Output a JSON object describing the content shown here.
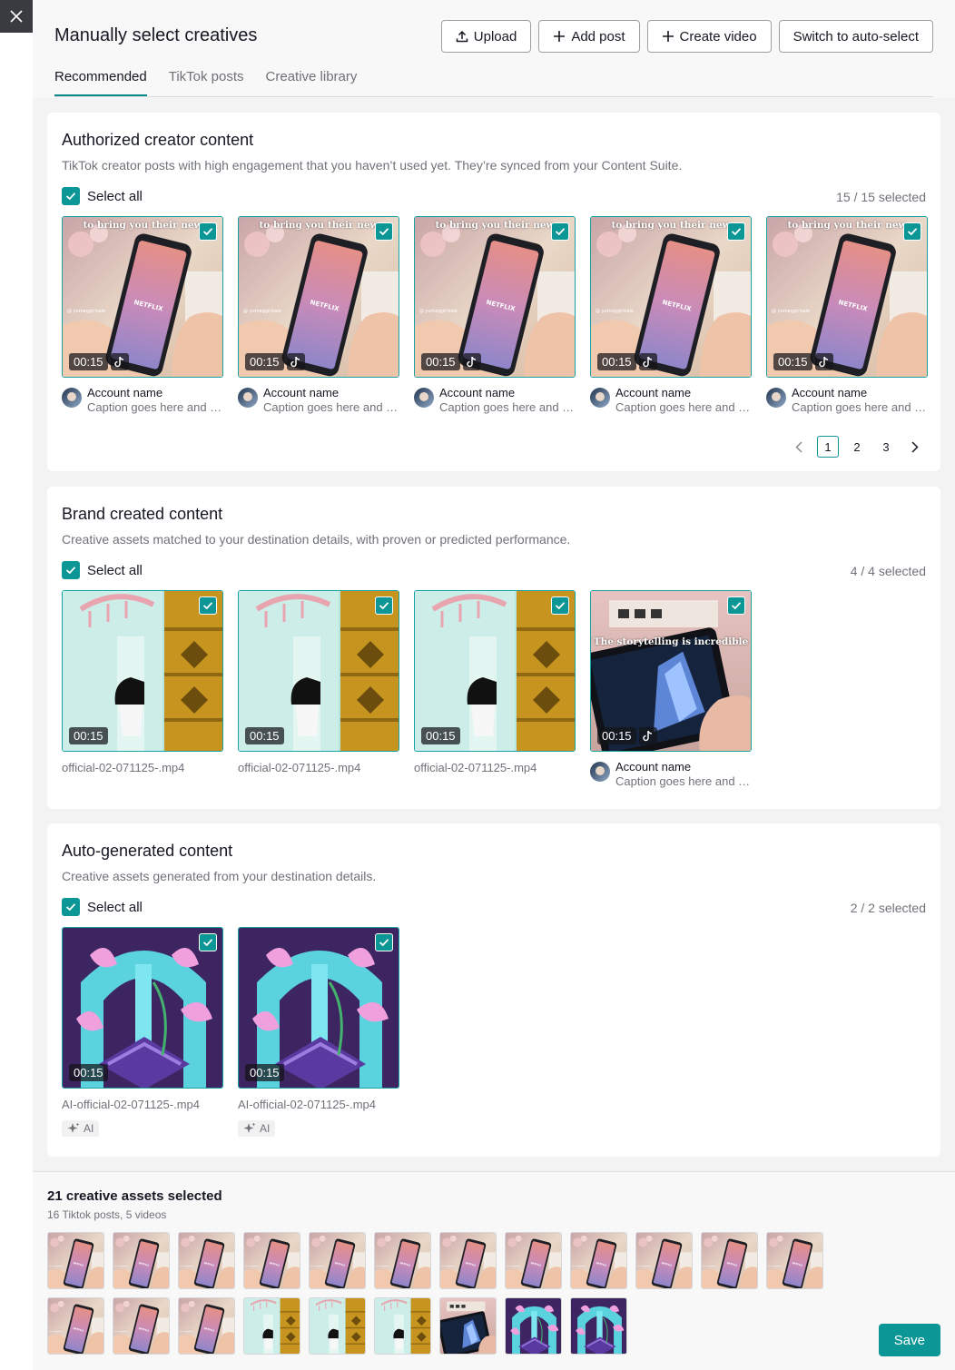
{
  "header": {
    "title": "Manually select creatives",
    "buttons": {
      "upload": "Upload",
      "add_post": "Add post",
      "create_video": "Create video",
      "switch_auto": "Switch to auto-select"
    },
    "tabs": [
      "Recommended",
      "TikTok posts",
      "Creative library"
    ],
    "active_tab": "Recommended"
  },
  "sections": {
    "authorized": {
      "title": "Authorized creator content",
      "description": "TikTok creator posts with high engagement that you haven’t used yet. They’re synced from your Content Suite.",
      "select_all": "Select all",
      "count": "15 / 15 selected",
      "items": [
        {
          "duration": "00:15",
          "overlay": "to bring you their new",
          "account": "Account name",
          "caption": "Caption goes here and truncates"
        },
        {
          "duration": "00:15",
          "overlay": "to bring you their new",
          "account": "Account name",
          "caption": "Caption goes here and truncates"
        },
        {
          "duration": "00:15",
          "overlay": "to bring you their new",
          "account": "Account name",
          "caption": "Caption goes here and truncates"
        },
        {
          "duration": "00:15",
          "overlay": "to bring you their new",
          "account": "Account name",
          "caption": "Caption goes here and truncates"
        },
        {
          "duration": "00:15",
          "overlay": "to bring you their new",
          "account": "Account name",
          "caption": "Caption goes here and truncates"
        }
      ],
      "pagination": {
        "pages": [
          "1",
          "2",
          "3"
        ],
        "current": "1"
      }
    },
    "brand": {
      "title": "Brand created content",
      "description": "Creative assets matched to your destination details, with proven or predicted performance.",
      "select_all": "Select all",
      "count": "4 / 4 selected",
      "items": [
        {
          "duration": "00:15",
          "filename": "official-02-071125-.mp4"
        },
        {
          "duration": "00:15",
          "filename": "official-02-071125-.mp4"
        },
        {
          "duration": "00:15",
          "filename": "official-02-071125-.mp4"
        },
        {
          "duration": "00:15",
          "overlay": "The storytelling is incredible",
          "account": "Account name",
          "caption": "Caption goes here and truncates"
        }
      ]
    },
    "auto": {
      "title": "Auto-generated content",
      "description": "Creative assets generated from your destination details.",
      "select_all": "Select all",
      "count": "2 / 2 selected",
      "items": [
        {
          "duration": "00:15",
          "filename": "AI-official-02-071125-.mp4",
          "tag": "AI"
        },
        {
          "duration": "00:15",
          "filename": "AI-official-02-071125-.mp4",
          "tag": "AI"
        }
      ]
    }
  },
  "footer": {
    "title": "21 creative assets selected",
    "subtitle": "16 Tiktok posts, 5 videos",
    "save": "Save",
    "thumbnails": [
      "phone",
      "phone",
      "phone",
      "phone",
      "phone",
      "phone",
      "phone",
      "phone",
      "phone",
      "phone",
      "phone",
      "phone",
      "phone",
      "phone",
      "phone",
      "game",
      "game",
      "game",
      "tablet",
      "ai",
      "ai"
    ]
  },
  "colors": {
    "accent": "#0d9696",
    "border": "#15a3a3"
  }
}
